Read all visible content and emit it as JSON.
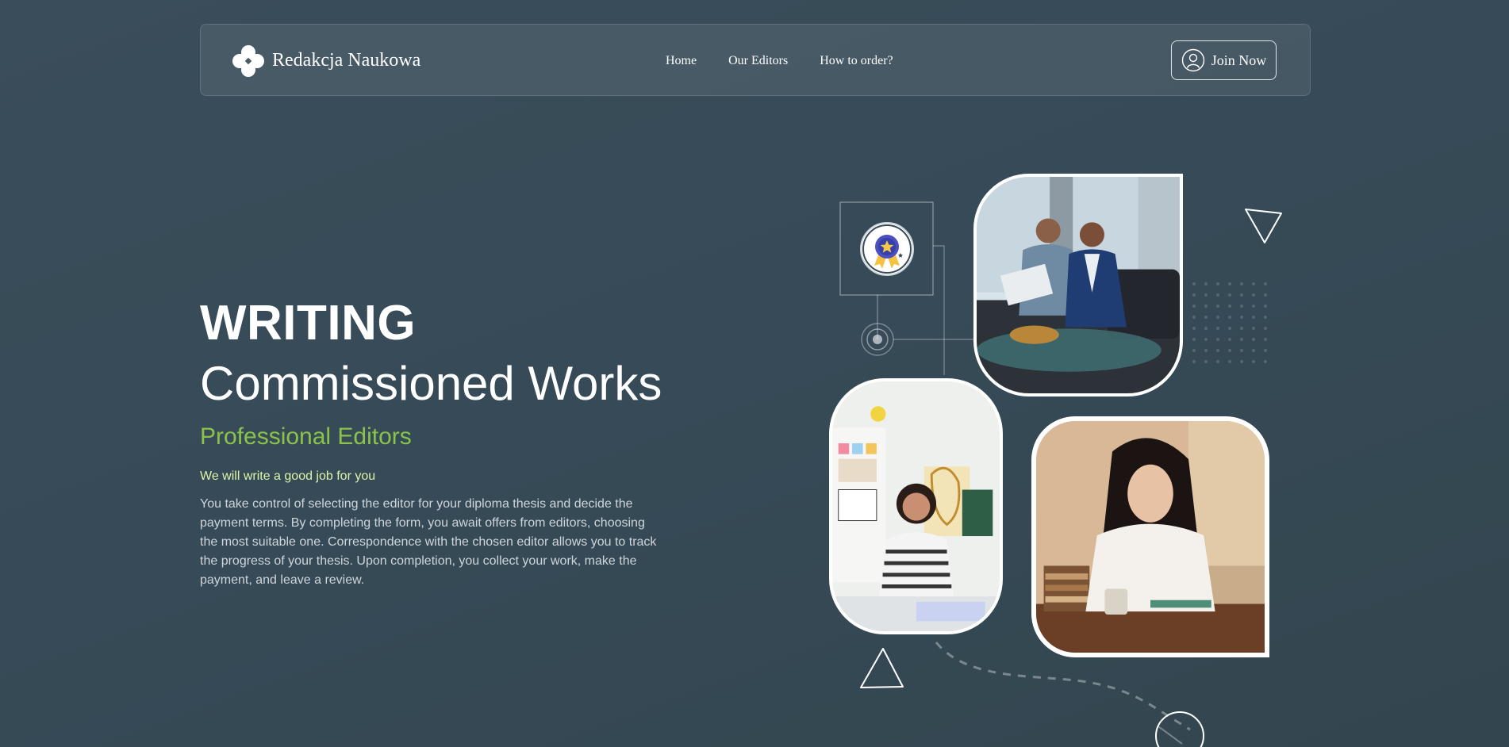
{
  "brand": {
    "name": "Redakcja Naukowa",
    "logo_icon": "flower-cross-icon"
  },
  "nav": [
    {
      "label": "Home"
    },
    {
      "label": "Our Editors"
    },
    {
      "label": "How to order?"
    }
  ],
  "join": {
    "label": "Join Now",
    "icon": "user-circle-icon"
  },
  "hero": {
    "title_line1": "WRITING",
    "title_line2": "Commissioned Works",
    "subtitle": "Professional Editors",
    "tagline": "We will write a good job for you",
    "description": "You take control of selecting the editor for your diploma thesis and decide the payment terms. By completing the form, you await offers from editors, choosing the most suitable one. Correspondence with the chosen editor allows you to track the progress of your thesis. Upon completion, you collect your work, make the payment, and leave a review."
  },
  "colors": {
    "background": "#364a57",
    "accent_green": "#8bc34a",
    "tagline_green": "#ddf3a8"
  }
}
